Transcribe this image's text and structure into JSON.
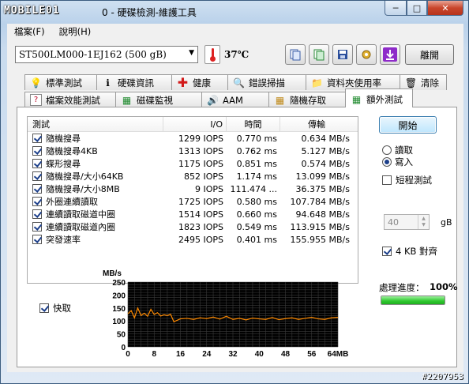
{
  "window": {
    "logo_text": "MOBILE01",
    "title": "0 - 硬碟檢測-維護工具",
    "min_label": "─",
    "max_label": "□",
    "close_label": "✕"
  },
  "menu": [
    {
      "label": "檔案(F)"
    },
    {
      "label": "說明(H)"
    }
  ],
  "toolbar": {
    "drive": "ST500LM000-1EJ162 (500 gB)",
    "temperature": "37℃",
    "exit_label": "離開",
    "icons": [
      "copy-icon",
      "copy-green-icon",
      "save-icon",
      "settings-icon",
      "download-icon"
    ]
  },
  "tabs_row1": [
    {
      "label": "標準測試",
      "icon": "💡"
    },
    {
      "label": "硬碟資訊",
      "icon": "ℹ"
    },
    {
      "label": "健康",
      "icon": "✚"
    },
    {
      "label": "錯誤掃描",
      "icon": "🔍"
    },
    {
      "label": "資料夾使用率",
      "icon": "📁"
    },
    {
      "label": "清除",
      "icon": "🗑"
    }
  ],
  "tabs_row2": [
    {
      "label": "檔案效能測試",
      "icon": "?"
    },
    {
      "label": "磁碟監視",
      "icon": "▦"
    },
    {
      "label": "AAM",
      "icon": "🔊"
    },
    {
      "label": "隨機存取",
      "icon": "▦"
    },
    {
      "label": "額外測試",
      "icon": "▦",
      "active": true
    }
  ],
  "table": {
    "headers": [
      "測試",
      "I/O",
      "時間",
      "傳輸"
    ],
    "rows": [
      {
        "name": "隨機搜尋",
        "io": "1299 IOPS",
        "time": "0.770 ms",
        "rate": "0.634 MB/s"
      },
      {
        "name": "隨機搜尋4KB",
        "io": "1313 IOPS",
        "time": "0.762 ms",
        "rate": "5.127 MB/s"
      },
      {
        "name": "蝶形搜尋",
        "io": "1175 IOPS",
        "time": "0.851 ms",
        "rate": "0.574 MB/s"
      },
      {
        "name": "隨機搜尋/大小64KB",
        "io": "852 IOPS",
        "time": "1.174 ms",
        "rate": "13.099 MB/s"
      },
      {
        "name": "隨機搜尋/大小8MB",
        "io": "9 IOPS",
        "time": "111.474 ...",
        "rate": "36.375 MB/s"
      },
      {
        "name": "外圈連續讀取",
        "io": "1725 IOPS",
        "time": "0.580 ms",
        "rate": "107.784 MB/s"
      },
      {
        "name": "連續讀取磁道中圈",
        "io": "1514 IOPS",
        "time": "0.660 ms",
        "rate": "94.648 MB/s"
      },
      {
        "name": "連續讀取磁道內圈",
        "io": "1823 IOPS",
        "time": "0.549 ms",
        "rate": "113.915 MB/s"
      },
      {
        "name": "突發速率",
        "io": "2495 IOPS",
        "time": "0.401 ms",
        "rate": "155.955 MB/s"
      }
    ]
  },
  "controls": {
    "start_label": "開始",
    "read_label": "讀取",
    "write_label": "寫入",
    "short_test_label": "短程測試",
    "size_value": "40",
    "size_unit": "gB",
    "align_label": "4 KB 對齊",
    "progress_label": "處理進度：",
    "progress_value": "100%",
    "progress_fraction": 1.0,
    "quick_label": "快取"
  },
  "chart_data": {
    "type": "line",
    "ylabel": "MB/s",
    "xlabel_suffix": "64MB",
    "ylim": [
      0,
      250
    ],
    "xlim": [
      0,
      64
    ],
    "yticks": [
      0,
      50,
      100,
      150,
      200,
      250
    ],
    "xticks": [
      0,
      8,
      16,
      24,
      32,
      40,
      48,
      56
    ],
    "x_tick_labels": [
      "0",
      "8",
      "16",
      "24",
      "32",
      "40",
      "48",
      "56",
      "64MB"
    ],
    "series": [
      {
        "color": "#ff8a00",
        "x": [
          0,
          1,
          2,
          3,
          4,
          5,
          6,
          7,
          8,
          9,
          10,
          11,
          12,
          13,
          14,
          16,
          18,
          20,
          22,
          24,
          26,
          28,
          30,
          32,
          34,
          36,
          38,
          40,
          42,
          44,
          46,
          48,
          50,
          52,
          54,
          56,
          58,
          60,
          62,
          64
        ],
        "y": [
          128,
          140,
          112,
          150,
          121,
          130,
          118,
          145,
          125,
          132,
          119,
          124,
          121,
          126,
          97,
          108,
          110,
          106,
          112,
          109,
          115,
          107,
          118,
          106,
          110,
          104,
          111,
          108,
          106,
          113,
          105,
          109,
          112,
          106,
          110,
          114,
          108,
          106,
          112,
          114
        ]
      }
    ]
  },
  "footer": {
    "watermark": "#2207953"
  }
}
